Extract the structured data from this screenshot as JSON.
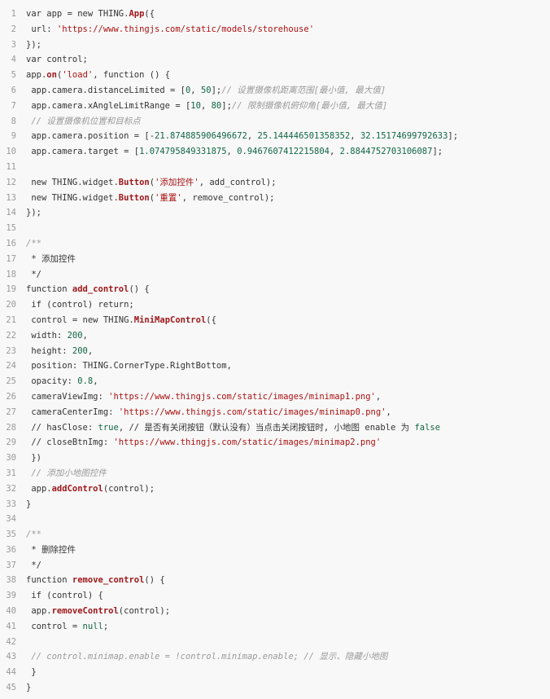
{
  "code": {
    "lines": [
      {
        "n": "1",
        "tokens": [
          {
            "t": "var app = new THING.",
            "c": "default"
          },
          {
            "t": "App",
            "c": "fn"
          },
          {
            "t": "({",
            "c": "default"
          }
        ]
      },
      {
        "n": "2",
        "tokens": [
          {
            "t": " url: ",
            "c": "default"
          },
          {
            "t": "'https://www.thingjs.com/static/models/storehouse'",
            "c": "str"
          }
        ]
      },
      {
        "n": "3",
        "tokens": [
          {
            "t": "});",
            "c": "default"
          }
        ]
      },
      {
        "n": "4",
        "tokens": [
          {
            "t": "var control;",
            "c": "default"
          }
        ]
      },
      {
        "n": "5",
        "tokens": [
          {
            "t": "app.",
            "c": "default"
          },
          {
            "t": "on",
            "c": "fn"
          },
          {
            "t": "(",
            "c": "default"
          },
          {
            "t": "'load'",
            "c": "str"
          },
          {
            "t": ", function () {",
            "c": "default"
          }
        ]
      },
      {
        "n": "6",
        "tokens": [
          {
            "t": " app.camera.distanceLimited = [",
            "c": "default"
          },
          {
            "t": "0",
            "c": "num"
          },
          {
            "t": ", ",
            "c": "default"
          },
          {
            "t": "50",
            "c": "num"
          },
          {
            "t": "];",
            "c": "default"
          },
          {
            "t": "// 设置摄像机距离范围[最小值, 最大值]",
            "c": "comment"
          }
        ]
      },
      {
        "n": "7",
        "tokens": [
          {
            "t": " app.camera.xAngleLimitRange = [",
            "c": "default"
          },
          {
            "t": "10",
            "c": "num"
          },
          {
            "t": ", ",
            "c": "default"
          },
          {
            "t": "80",
            "c": "num"
          },
          {
            "t": "];",
            "c": "default"
          },
          {
            "t": "// 限制摄像机俯仰角[最小值, 最大值]",
            "c": "comment"
          }
        ]
      },
      {
        "n": "8",
        "tokens": [
          {
            "t": " // 设置摄像机位置和目标点",
            "c": "comment"
          }
        ]
      },
      {
        "n": "9",
        "tokens": [
          {
            "t": " app.camera.position = [-",
            "c": "default"
          },
          {
            "t": "21.874885906496672",
            "c": "num"
          },
          {
            "t": ", ",
            "c": "default"
          },
          {
            "t": "25.144446501358352",
            "c": "num"
          },
          {
            "t": ", ",
            "c": "default"
          },
          {
            "t": "32.15174699792633",
            "c": "num"
          },
          {
            "t": "];",
            "c": "default"
          }
        ]
      },
      {
        "n": "10",
        "tokens": [
          {
            "t": " app.camera.target = [",
            "c": "default"
          },
          {
            "t": "1.074795849331875",
            "c": "num"
          },
          {
            "t": ", ",
            "c": "default"
          },
          {
            "t": "0.9467607412215804",
            "c": "num"
          },
          {
            "t": ", ",
            "c": "default"
          },
          {
            "t": "2.8844752703106087",
            "c": "num"
          },
          {
            "t": "];",
            "c": "default"
          }
        ]
      },
      {
        "n": "11",
        "tokens": []
      },
      {
        "n": "12",
        "tokens": [
          {
            "t": " new THING.widget.",
            "c": "default"
          },
          {
            "t": "Button",
            "c": "fn"
          },
          {
            "t": "(",
            "c": "default"
          },
          {
            "t": "'添加控件'",
            "c": "str"
          },
          {
            "t": ", add_control);",
            "c": "default"
          }
        ]
      },
      {
        "n": "13",
        "tokens": [
          {
            "t": " new THING.widget.",
            "c": "default"
          },
          {
            "t": "Button",
            "c": "fn"
          },
          {
            "t": "(",
            "c": "default"
          },
          {
            "t": "'重置'",
            "c": "str"
          },
          {
            "t": ", remove_control);",
            "c": "default"
          }
        ]
      },
      {
        "n": "14",
        "tokens": [
          {
            "t": "});",
            "c": "default"
          }
        ]
      },
      {
        "n": "15",
        "tokens": []
      },
      {
        "n": "16",
        "tokens": [
          {
            "t": "/**",
            "c": "comment"
          }
        ]
      },
      {
        "n": "17",
        "tokens": [
          {
            "t": " * 添加控件",
            "c": "default"
          }
        ]
      },
      {
        "n": "18",
        "tokens": [
          {
            "t": " */",
            "c": "default"
          }
        ]
      },
      {
        "n": "19",
        "tokens": [
          {
            "t": "function ",
            "c": "default"
          },
          {
            "t": "add_control",
            "c": "fn"
          },
          {
            "t": "() {",
            "c": "default"
          }
        ]
      },
      {
        "n": "20",
        "tokens": [
          {
            "t": " if (control) return;",
            "c": "default"
          }
        ]
      },
      {
        "n": "21",
        "tokens": [
          {
            "t": " control = new THING.",
            "c": "default"
          },
          {
            "t": "MiniMapControl",
            "c": "fn"
          },
          {
            "t": "({",
            "c": "default"
          }
        ]
      },
      {
        "n": "22",
        "tokens": [
          {
            "t": " width: ",
            "c": "default"
          },
          {
            "t": "200",
            "c": "num"
          },
          {
            "t": ",",
            "c": "default"
          }
        ]
      },
      {
        "n": "23",
        "tokens": [
          {
            "t": " height: ",
            "c": "default"
          },
          {
            "t": "200",
            "c": "num"
          },
          {
            "t": ",",
            "c": "default"
          }
        ]
      },
      {
        "n": "24",
        "tokens": [
          {
            "t": " position: THING.CornerType.RightBottom,",
            "c": "default"
          }
        ]
      },
      {
        "n": "25",
        "tokens": [
          {
            "t": " opacity: ",
            "c": "default"
          },
          {
            "t": "0.8",
            "c": "num"
          },
          {
            "t": ",",
            "c": "default"
          }
        ]
      },
      {
        "n": "26",
        "tokens": [
          {
            "t": " cameraViewImg: ",
            "c": "default"
          },
          {
            "t": "'https://www.thingjs.com/static/images/minimap1.png'",
            "c": "str"
          },
          {
            "t": ",",
            "c": "default"
          }
        ]
      },
      {
        "n": "27",
        "tokens": [
          {
            "t": " cameraCenterImg: ",
            "c": "default"
          },
          {
            "t": "'https://www.thingjs.com/static/images/minimap0.png'",
            "c": "str"
          },
          {
            "t": ",",
            "c": "default"
          }
        ]
      },
      {
        "n": "28",
        "tokens": [
          {
            "t": " // hasClose: ",
            "c": "default"
          },
          {
            "t": "true",
            "c": "bool"
          },
          {
            "t": ", // 是否有关闭按钮（默认没有）当点击关闭按钮时, 小地图 enable 为 ",
            "c": "default"
          },
          {
            "t": "false",
            "c": "bool"
          }
        ]
      },
      {
        "n": "29",
        "tokens": [
          {
            "t": " // closeBtnImg: ",
            "c": "default"
          },
          {
            "t": "'https://www.thingjs.com/static/images/minimap2.png'",
            "c": "str"
          }
        ]
      },
      {
        "n": "30",
        "tokens": [
          {
            "t": " })",
            "c": "default"
          }
        ]
      },
      {
        "n": "31",
        "tokens": [
          {
            "t": " // 添加小地图控件",
            "c": "comment"
          }
        ]
      },
      {
        "n": "32",
        "tokens": [
          {
            "t": " app.",
            "c": "default"
          },
          {
            "t": "addControl",
            "c": "fn"
          },
          {
            "t": "(control);",
            "c": "default"
          }
        ]
      },
      {
        "n": "33",
        "tokens": [
          {
            "t": "}",
            "c": "default"
          }
        ]
      },
      {
        "n": "34",
        "tokens": []
      },
      {
        "n": "35",
        "tokens": [
          {
            "t": "/**",
            "c": "comment"
          }
        ]
      },
      {
        "n": "36",
        "tokens": [
          {
            "t": " * 删除控件",
            "c": "default"
          }
        ]
      },
      {
        "n": "37",
        "tokens": [
          {
            "t": " */",
            "c": "default"
          }
        ]
      },
      {
        "n": "38",
        "tokens": [
          {
            "t": "function ",
            "c": "default"
          },
          {
            "t": "remove_control",
            "c": "fn"
          },
          {
            "t": "() {",
            "c": "default"
          }
        ]
      },
      {
        "n": "39",
        "tokens": [
          {
            "t": " if (control) {",
            "c": "default"
          }
        ]
      },
      {
        "n": "40",
        "tokens": [
          {
            "t": " app.",
            "c": "default"
          },
          {
            "t": "removeControl",
            "c": "fn"
          },
          {
            "t": "(control);",
            "c": "default"
          }
        ]
      },
      {
        "n": "41",
        "tokens": [
          {
            "t": " control = ",
            "c": "default"
          },
          {
            "t": "null",
            "c": "bool"
          },
          {
            "t": ";",
            "c": "default"
          }
        ]
      },
      {
        "n": "42",
        "tokens": []
      },
      {
        "n": "43",
        "tokens": [
          {
            "t": " // control.minimap.enable = !control.minimap.enable; // 显示、隐藏小地图",
            "c": "comment"
          }
        ]
      },
      {
        "n": "44",
        "tokens": [
          {
            "t": " }",
            "c": "default"
          }
        ]
      },
      {
        "n": "45",
        "tokens": [
          {
            "t": "}",
            "c": "default"
          }
        ]
      }
    ]
  },
  "colors": {
    "background": "#f8f8f8",
    "text": "#333333",
    "line_number": "#999999",
    "function_name": "#a0171a",
    "string": "#aa1111",
    "number": "#116644",
    "comment": "#999999"
  }
}
